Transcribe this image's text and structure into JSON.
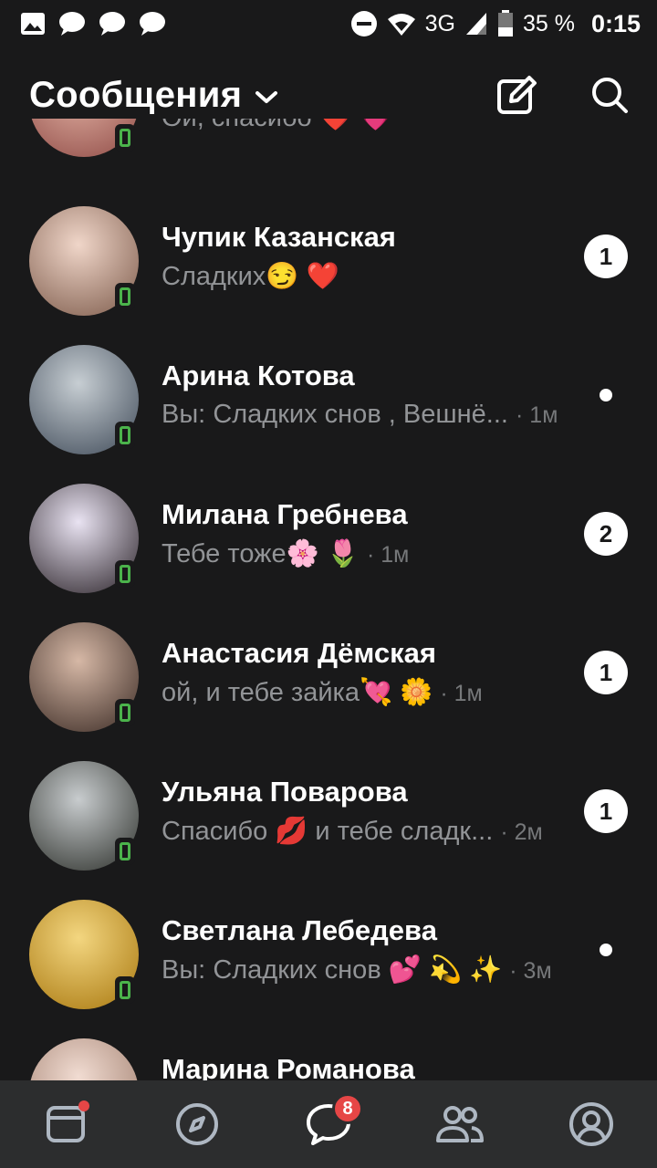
{
  "status_bar": {
    "network": "3G",
    "battery": "35 %",
    "time": "0:15",
    "icons": [
      "gallery-icon",
      "message-icon",
      "message-icon",
      "message-icon",
      "dnd-icon",
      "wifi-icon",
      "signal-icon",
      "battery-icon"
    ]
  },
  "header": {
    "title": "Сообщения",
    "icons": [
      "chevron-down-icon",
      "compose-icon",
      "search-icon"
    ]
  },
  "conversations": [
    {
      "name": "",
      "preview": "Ой, спасибо ❤️ 💗",
      "time": "",
      "badge": "",
      "unread_dot": false,
      "online": true,
      "colors": [
        "#e7b7a9",
        "#8e4a45"
      ]
    },
    {
      "name": "Чупик Казанская",
      "preview": "Сладких😏 ❤️",
      "time": "",
      "badge": "1",
      "unread_dot": false,
      "online": true,
      "colors": [
        "#f0d6c9",
        "#7c5a4a"
      ]
    },
    {
      "name": "Арина Котова",
      "you_prefix": "Вы:",
      "preview": "Сладких снов , Вешнё...",
      "time": "· 1м",
      "badge": "",
      "unread_dot": true,
      "online": true,
      "colors": [
        "#c7ced3",
        "#3f4a58"
      ]
    },
    {
      "name": "Милана Гребнева",
      "preview": "Тебе тоже🌸 🌷",
      "time": "· 1м",
      "badge": "2",
      "unread_dot": false,
      "online": true,
      "colors": [
        "#e9e3f2",
        "#2a2228"
      ]
    },
    {
      "name": "Анастасия Дёмская",
      "preview": "ой, и тебе зайка💘 🌼",
      "time": "· 1м",
      "badge": "1",
      "unread_dot": false,
      "online": true,
      "colors": [
        "#d6b8a6",
        "#3a2a24"
      ]
    },
    {
      "name": "Ульяна Поварова",
      "preview": "Спасибо 💋  и тебе сладк...",
      "time": "· 2м",
      "badge": "1",
      "unread_dot": false,
      "online": true,
      "colors": [
        "#c8ccce",
        "#2c2f2a"
      ]
    },
    {
      "name": "Светлана Лебедева",
      "you_prefix": "Вы:",
      "preview": "Сладких снов 💕 💫 ✨",
      "time": "· 3м",
      "badge": "",
      "unread_dot": true,
      "online": true,
      "colors": [
        "#f3d680",
        "#a8770e"
      ]
    },
    {
      "name": "Марина Романова",
      "preview": "",
      "time": "",
      "badge": "",
      "unread_dot": false,
      "online": false,
      "colors": [
        "#f1dcd2",
        "#9b7867"
      ]
    }
  ],
  "tab_bar": {
    "tabs": [
      {
        "name": "tab-feed",
        "icon": "feed-icon",
        "badge": "",
        "dot": true,
        "active": false
      },
      {
        "name": "tab-discover",
        "icon": "compass-icon",
        "badge": "",
        "dot": false,
        "active": false
      },
      {
        "name": "tab-messages",
        "icon": "chat-icon",
        "badge": "8",
        "dot": false,
        "active": true
      },
      {
        "name": "tab-friends",
        "icon": "friends-icon",
        "badge": "",
        "dot": false,
        "active": false
      },
      {
        "name": "tab-profile",
        "icon": "profile-icon",
        "badge": "",
        "dot": false,
        "active": false
      }
    ]
  }
}
